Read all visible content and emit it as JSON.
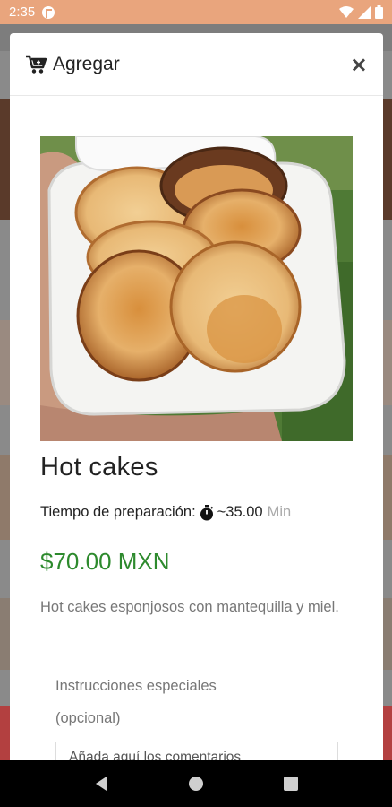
{
  "status_bar": {
    "time": "2:35"
  },
  "modal": {
    "title": "Agregar",
    "close_label": "×"
  },
  "product": {
    "name": "Hot cakes",
    "prep_label": "Tiempo de preparación:",
    "prep_value": "~35.00",
    "prep_unit": "Min",
    "price": "$70.00 MXN",
    "description": "Hot cakes esponjosos con mantequilla y miel."
  },
  "instructions": {
    "label": "Instrucciones especiales (opcional)",
    "placeholder": "Añada aquí los comentarios"
  },
  "colors": {
    "status_bar": "#e9a57d",
    "price": "#2d8a2d",
    "overlay": "#6f6f6f"
  }
}
